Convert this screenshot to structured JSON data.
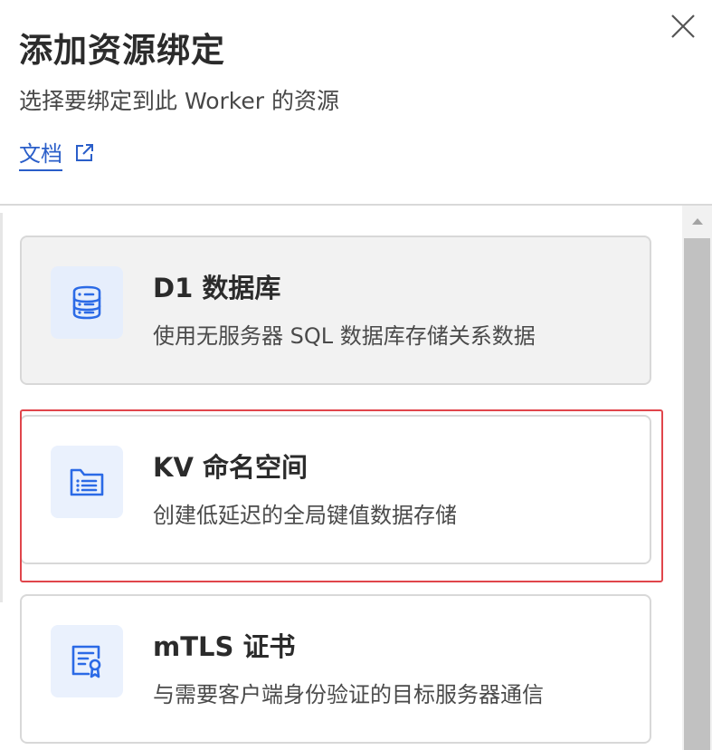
{
  "panel": {
    "title": "添加资源绑定",
    "subtitle": "选择要绑定到此 Worker 的资源",
    "docs_link": {
      "label": "文档",
      "icon": "external-link-icon"
    },
    "close_icon": "close-icon"
  },
  "accent_color": "#2a5ec9",
  "highlight_color": "#e0454b",
  "resources": [
    {
      "title": "D1 数据库",
      "description": "使用无服务器 SQL 数据库存储关系数据",
      "icon": "database-icon",
      "selected": true
    },
    {
      "title": "KV 命名空间",
      "description": "创建低延迟的全局键值数据存储",
      "icon": "folder-list-icon",
      "highlighted": true
    },
    {
      "title": "mTLS 证书",
      "description": "与需要客户端身份验证的目标服务器通信",
      "icon": "certificate-icon"
    }
  ]
}
